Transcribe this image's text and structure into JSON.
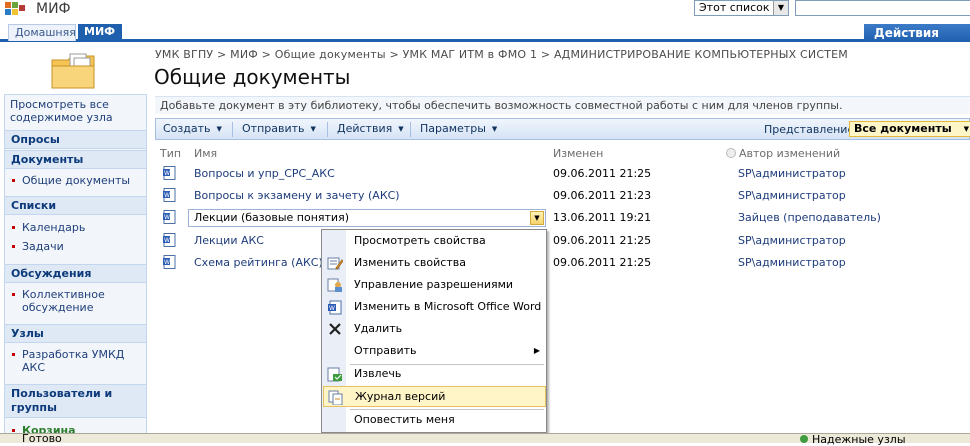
{
  "header": {
    "site_title": "МИФ",
    "scope": "Этот список",
    "tabs": [
      {
        "label": "Домашняя"
      },
      {
        "label": "МИФ"
      }
    ],
    "site_actions": "Действия узла"
  },
  "breadcrumb": "УМК ВГПУ > МИФ > Общие документы > УМК МАГ ИТМ в ФМО 1 > АДМИНИСТРИРОВАНИЕ КОМПЬЮТЕРНЫХ СИСТЕМ",
  "page_title": "Общие документы",
  "leftnav": {
    "view_all": "Просмотреть все содержимое узла",
    "sections": [
      {
        "head": "Опросы",
        "items": []
      },
      {
        "head": "Документы",
        "items": [
          "Общие документы"
        ]
      },
      {
        "head": "Списки",
        "items": [
          "Календарь",
          "Задачи"
        ]
      },
      {
        "head": "Обсуждения",
        "items": [
          "Коллективное обсуждение"
        ]
      },
      {
        "head": "Узлы",
        "items": [
          "Разработка УМКД АКС"
        ]
      },
      {
        "head": "Пользователи и группы",
        "items": [
          "Корзина"
        ]
      }
    ]
  },
  "description": "Добавьте документ в эту библиотеку, чтобы обеспечить возможность совместной работы с ним для членов группы.",
  "toolbar": {
    "create": "Создать",
    "send": "Отправить",
    "actions": "Действия",
    "params": "Параметры",
    "view_label": "Представление:",
    "view_value": "Все документы"
  },
  "columns": {
    "type": "Тип",
    "name": "Имя",
    "modified": "Изменен",
    "author": "Автор изменений"
  },
  "rows": [
    {
      "name": "Вопросы и упр_СРС_АКС",
      "modified": "09.06.2011 21:25",
      "author": "SP\\администратор"
    },
    {
      "name": "Вопросы к экзамену и зачету (АКС)",
      "modified": "09.06.2011 21:23",
      "author": "SP\\администратор"
    },
    {
      "name": "Лекции (базовые понятия)",
      "modified": "13.06.2011 19:21",
      "author": "Зайцев (преподаватель)"
    },
    {
      "name": "Лекции АКС",
      "modified": "09.06.2011 21:25",
      "author": "SP\\администратор"
    },
    {
      "name": "Схема рейтинга (АКС)",
      "modified": "09.06.2011 21:25",
      "author": "SP\\администратор"
    }
  ],
  "context_menu": {
    "items": [
      {
        "label": "Просмотреть свойства",
        "icon": "none"
      },
      {
        "label": "Изменить свойства",
        "icon": "edit-properties-icon"
      },
      {
        "label": "Управление разрешениями",
        "icon": "permissions-icon"
      },
      {
        "label": "Изменить в Microsoft Office Word",
        "icon": "word-doc-icon"
      },
      {
        "label": "Удалить",
        "icon": "delete-x-icon"
      },
      {
        "label": "Отправить",
        "icon": "none"
      },
      {
        "label": "Извлечь",
        "icon": "checkout-icon"
      },
      {
        "label": "Журнал версий",
        "icon": "version-history-icon"
      },
      {
        "label": "Оповестить меня",
        "icon": "none"
      }
    ]
  },
  "status": {
    "text": "Готово",
    "zone": "Надежные узлы"
  },
  "colors": {
    "accent": "#1e5fae",
    "menu_highlight": "#fff5c6"
  }
}
